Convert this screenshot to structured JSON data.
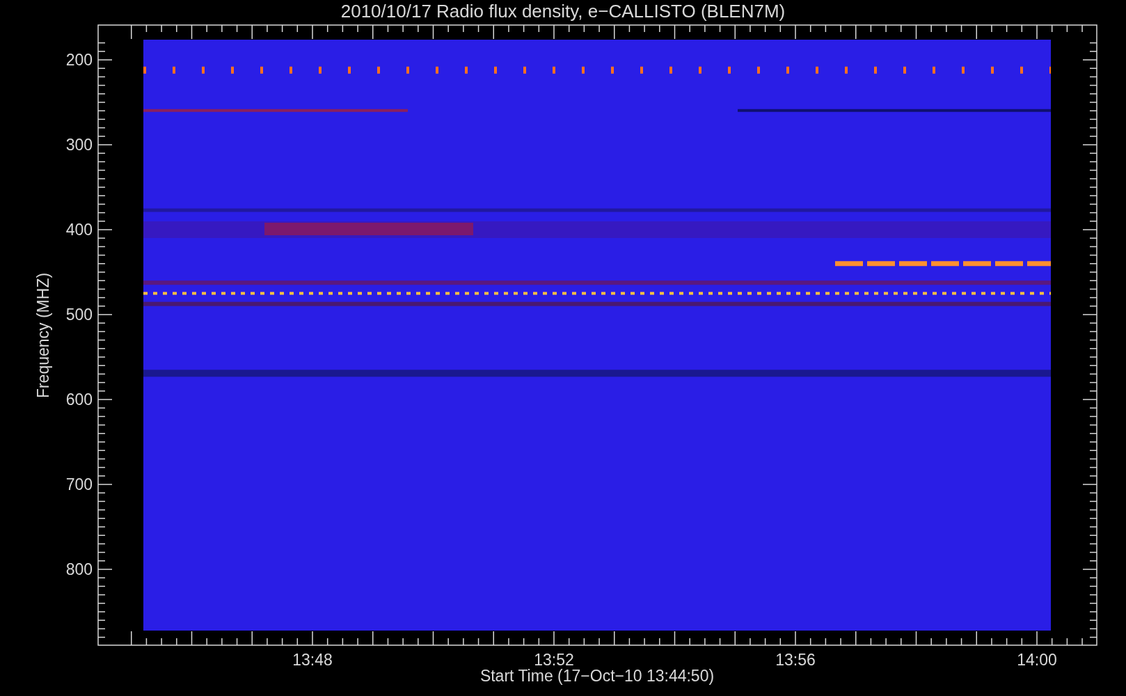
{
  "title": "2010/10/17  Radio flux density, e−CALLISTO (BLEN7M)",
  "y_axis": {
    "label": "Frequency (MHZ)",
    "ticks": [
      "200",
      "300",
      "400",
      "500",
      "600",
      "700",
      "800"
    ]
  },
  "x_axis": {
    "label": "Start Time (17−Oct−10 13:44:50)",
    "ticks": [
      "13:48",
      "13:52",
      "13:56",
      "14:00"
    ]
  }
}
